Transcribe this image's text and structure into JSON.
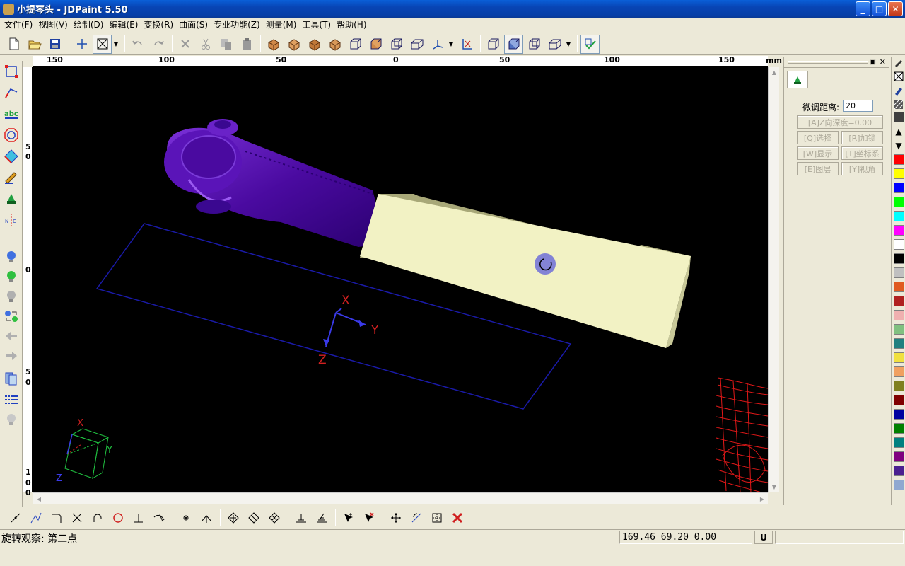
{
  "window": {
    "title": "小提琴头 - JDPaint 5.50",
    "min_label": "_",
    "max_label": "□",
    "close_label": "✕"
  },
  "menu": [
    "文件(F)",
    "视图(V)",
    "绘制(D)",
    "编辑(E)",
    "变换(R)",
    "曲面(S)",
    "专业功能(Z)",
    "测量(M)",
    "工具(T)",
    "帮助(H)"
  ],
  "ruler": {
    "unit": "mm",
    "h_labels": [
      "150",
      "100",
      "50",
      "0",
      "50",
      "100",
      "150"
    ],
    "v_labels": [
      "5",
      "0",
      "0",
      "5",
      "0",
      "1",
      "0",
      "0"
    ]
  },
  "viewport": {
    "axis_x": "X",
    "axis_y": "Y",
    "axis_z": "Z",
    "mini_x": "X",
    "mini_y": "Y",
    "mini_z": "Z",
    "colors": {
      "background": "#000000",
      "model_purple": "#5a12b0",
      "block": "#f2f2c4",
      "rect_outline": "#1a1aa8"
    }
  },
  "panel": {
    "fine_dist_label": "微调距离:",
    "fine_dist_value": "20",
    "z_depth": "[A]Z向深度=0.00",
    "btn_select": "[Q]选择",
    "btn_lock": "[R]加锁",
    "btn_show": "[W]显示",
    "btn_coord": "[T]坐标系",
    "btn_layer": "[E]图层",
    "btn_view": "[Y]视角"
  },
  "palette": [
    "#404040",
    "#ff0000",
    "#ffff00",
    "#0000ff",
    "#00ff00",
    "#00ffff",
    "#ff00ff",
    "#ffffff",
    "#000000",
    "#c0c0c0",
    "#e05a20",
    "#b02020",
    "#f0b0b0",
    "#80c080",
    "#208080",
    "#f0e040",
    "#f0a060",
    "#808020",
    "#800000",
    "#0000a0",
    "#008000",
    "#008080",
    "#800080",
    "#4a2090",
    "#90a8d0"
  ],
  "status": {
    "text": "旋转观察: 第二点",
    "coords": "169.46 69.20 0.00",
    "u_label": "U"
  }
}
